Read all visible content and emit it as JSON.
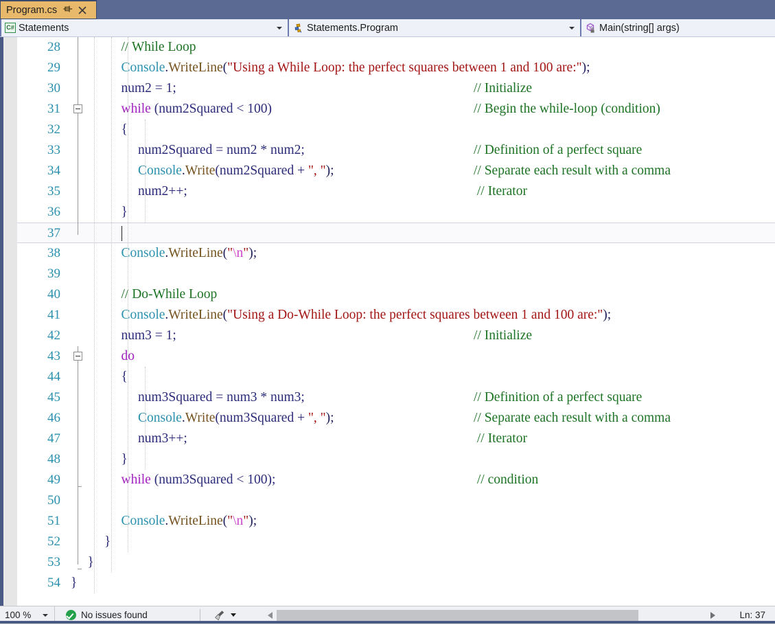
{
  "tab": {
    "label": "Program.cs",
    "pin_icon": "pin-icon",
    "close_icon": "close-icon",
    "active_bg": "#e8b96b",
    "strip_bg": "#5a6a92"
  },
  "navbar": {
    "project": {
      "icon": "csharp-file-icon",
      "icon_text": "C#",
      "label": "Statements"
    },
    "type": {
      "icon": "class-icon",
      "label": "Statements.Program"
    },
    "member": {
      "icon": "method-private-icon",
      "label": "Main(string[] args)"
    }
  },
  "editor": {
    "first_line": 28,
    "current_line": 37,
    "lines": [
      {
        "n": 28,
        "indent": 3,
        "tokens": [
          {
            "t": "// While Loop",
            "c": "com"
          }
        ]
      },
      {
        "n": 29,
        "indent": 3,
        "tokens": [
          {
            "t": "Console",
            "c": "type"
          },
          {
            "t": ".",
            "c": "plain"
          },
          {
            "t": "WriteLine",
            "c": "mth"
          },
          {
            "t": "(",
            "c": "plain"
          },
          {
            "t": "\"Using a While Loop: the perfect squares between 1 and 100 are:\"",
            "c": "str"
          },
          {
            "t": ");",
            "c": "plain"
          }
        ]
      },
      {
        "n": 30,
        "indent": 3,
        "tokens": [
          {
            "t": "num2 = 1;",
            "c": "id"
          }
        ],
        "comment": "// Initialize"
      },
      {
        "n": 31,
        "indent": 3,
        "fold": "open",
        "tokens": [
          {
            "t": "while",
            "c": "kw"
          },
          {
            "t": " (num2Squared < 100)",
            "c": "id"
          }
        ],
        "comment": "// Begin the while-loop (condition)"
      },
      {
        "n": 32,
        "indent": 3,
        "tokens": [
          {
            "t": "{",
            "c": "id"
          }
        ]
      },
      {
        "n": 33,
        "indent": 4,
        "tokens": [
          {
            "t": "num2Squared = num2 * num2;",
            "c": "id"
          }
        ],
        "comment": "// Definition of a perfect square"
      },
      {
        "n": 34,
        "indent": 4,
        "tokens": [
          {
            "t": "Console",
            "c": "type"
          },
          {
            "t": ".",
            "c": "plain"
          },
          {
            "t": "Write",
            "c": "mth"
          },
          {
            "t": "(num2Squared + ",
            "c": "id"
          },
          {
            "t": "\", \"",
            "c": "str"
          },
          {
            "t": ");",
            "c": "plain"
          }
        ],
        "comment": "// Separate each result with a comma"
      },
      {
        "n": 35,
        "indent": 4,
        "tokens": [
          {
            "t": "num2++;",
            "c": "id"
          }
        ],
        "comment": " // Iterator"
      },
      {
        "n": 36,
        "indent": 3,
        "tokens": [
          {
            "t": "}",
            "c": "id"
          }
        ]
      },
      {
        "n": 37,
        "indent": 3,
        "tokens": [],
        "current": true
      },
      {
        "n": 38,
        "indent": 3,
        "tokens": [
          {
            "t": "Console",
            "c": "type"
          },
          {
            "t": ".",
            "c": "plain"
          },
          {
            "t": "WriteLine",
            "c": "mth"
          },
          {
            "t": "(",
            "c": "plain"
          },
          {
            "t": "\"",
            "c": "str"
          },
          {
            "t": "\\n",
            "c": "esc"
          },
          {
            "t": "\"",
            "c": "str"
          },
          {
            "t": ");",
            "c": "plain"
          }
        ]
      },
      {
        "n": 39,
        "indent": 3,
        "tokens": []
      },
      {
        "n": 40,
        "indent": 3,
        "tokens": [
          {
            "t": "// Do-While Loop",
            "c": "com"
          }
        ]
      },
      {
        "n": 41,
        "indent": 3,
        "tokens": [
          {
            "t": "Console",
            "c": "type"
          },
          {
            "t": ".",
            "c": "plain"
          },
          {
            "t": "WriteLine",
            "c": "mth"
          },
          {
            "t": "(",
            "c": "plain"
          },
          {
            "t": "\"Using a Do-While Loop: the perfect squares between 1 and 100 are:\"",
            "c": "str"
          },
          {
            "t": ");",
            "c": "plain"
          }
        ]
      },
      {
        "n": 42,
        "indent": 3,
        "tokens": [
          {
            "t": "num3 = 1;",
            "c": "id"
          }
        ],
        "comment": "// Initialize"
      },
      {
        "n": 43,
        "indent": 3,
        "fold": "open",
        "tokens": [
          {
            "t": "do",
            "c": "kw"
          }
        ]
      },
      {
        "n": 44,
        "indent": 3,
        "tokens": [
          {
            "t": "{",
            "c": "id"
          }
        ]
      },
      {
        "n": 45,
        "indent": 4,
        "tokens": [
          {
            "t": "num3Squared = num3 * num3;",
            "c": "id"
          }
        ],
        "comment": "// Definition of a perfect square"
      },
      {
        "n": 46,
        "indent": 4,
        "tokens": [
          {
            "t": "Console",
            "c": "type"
          },
          {
            "t": ".",
            "c": "plain"
          },
          {
            "t": "Write",
            "c": "mth"
          },
          {
            "t": "(num3Squared + ",
            "c": "id"
          },
          {
            "t": "\", \"",
            "c": "str"
          },
          {
            "t": ");",
            "c": "plain"
          }
        ],
        "comment": "// Separate each result with a comma"
      },
      {
        "n": 47,
        "indent": 4,
        "tokens": [
          {
            "t": "num3++;",
            "c": "id"
          }
        ],
        "comment": " // Iterator"
      },
      {
        "n": 48,
        "indent": 3,
        "tokens": [
          {
            "t": "}",
            "c": "id"
          }
        ]
      },
      {
        "n": 49,
        "indent": 3,
        "tokens": [
          {
            "t": "while",
            "c": "kw"
          },
          {
            "t": " (num3Squared < 100);",
            "c": "id"
          }
        ],
        "comment": " // condition"
      },
      {
        "n": 50,
        "indent": 3,
        "tokens": []
      },
      {
        "n": 51,
        "indent": 3,
        "tokens": [
          {
            "t": "Console",
            "c": "type"
          },
          {
            "t": ".",
            "c": "plain"
          },
          {
            "t": "WriteLine",
            "c": "mth"
          },
          {
            "t": "(",
            "c": "plain"
          },
          {
            "t": "\"",
            "c": "str"
          },
          {
            "t": "\\n",
            "c": "esc"
          },
          {
            "t": "\"",
            "c": "str"
          },
          {
            "t": ");",
            "c": "plain"
          }
        ]
      },
      {
        "n": 52,
        "indent": 2,
        "tokens": [
          {
            "t": "}",
            "c": "id"
          }
        ]
      },
      {
        "n": 53,
        "indent": 1,
        "tokens": [
          {
            "t": "}",
            "c": "id"
          }
        ]
      },
      {
        "n": 54,
        "indent": 0,
        "tokens": [
          {
            "t": "}",
            "c": "id"
          }
        ]
      }
    ],
    "colors": {
      "comment": "#1d7324",
      "keyword": "#a020c0",
      "type": "#2b91af",
      "string": "#a31515",
      "escape": "#cc44cc",
      "identifier": "#2b2b7a",
      "method": "#74531f",
      "linenumber": "#2b91af"
    }
  },
  "statusbar": {
    "zoom": "100 %",
    "issues": "No issues found",
    "issues_icon": "check-circle-icon",
    "broom_icon": "broom-icon",
    "caret_position": "Ln: 37"
  }
}
